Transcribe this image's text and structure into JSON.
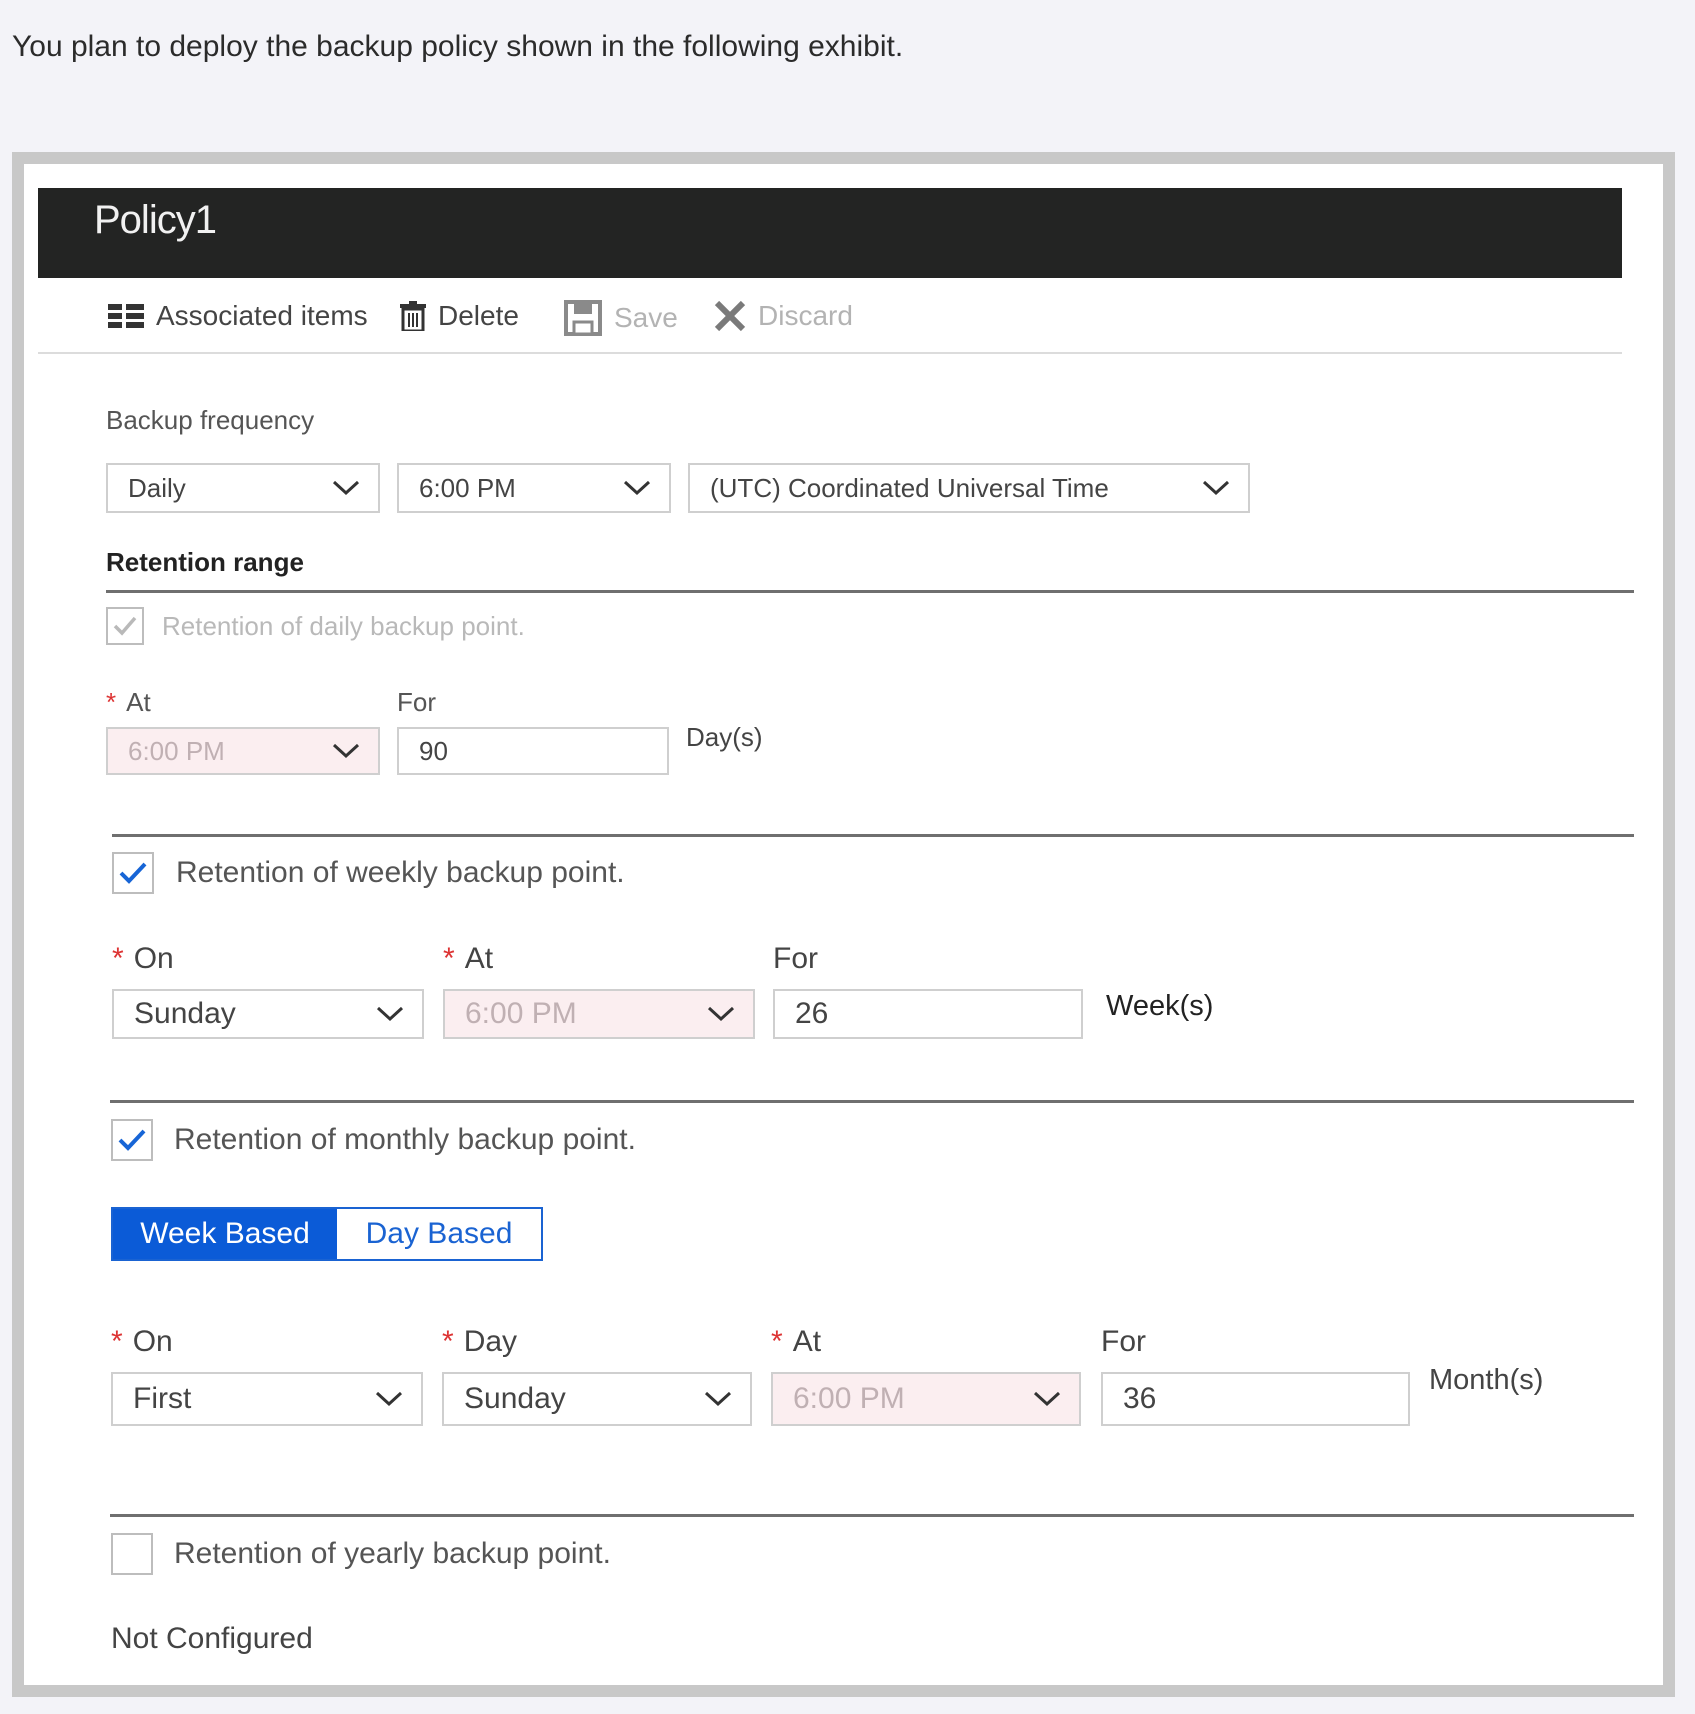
{
  "question": "You plan to deploy the backup policy shown in the following exhibit.",
  "policy": {
    "title": "Policy1",
    "toolbar": {
      "associated_items": "Associated items",
      "delete": "Delete",
      "save": "Save",
      "discard": "Discard"
    },
    "backup_frequency": {
      "label": "Backup frequency",
      "frequency": "Daily",
      "time": "6:00 PM",
      "timezone": "(UTC) Coordinated Universal Time"
    },
    "retention_range": {
      "title": "Retention range",
      "daily": {
        "label": "Retention of daily backup point.",
        "checked": true,
        "at_label": "At",
        "at_value": "6:00 PM",
        "for_label": "For",
        "for_value": "90",
        "unit": "Day(s)"
      },
      "weekly": {
        "label": "Retention of weekly backup point.",
        "checked": true,
        "on_label": "On",
        "on_value": "Sunday",
        "at_label": "At",
        "at_value": "6:00 PM",
        "for_label": "For",
        "for_value": "26",
        "unit": "Week(s)"
      },
      "monthly": {
        "label": "Retention of monthly backup point.",
        "checked": true,
        "tab_week": "Week Based",
        "tab_day": "Day Based",
        "on_label": "On",
        "on_value": "First",
        "day_label": "Day",
        "day_value": "Sunday",
        "at_label": "At",
        "at_value": "6:00 PM",
        "for_label": "For",
        "for_value": "36",
        "unit": "Month(s)"
      },
      "yearly": {
        "label": "Retention of yearly backup point.",
        "checked": false,
        "status": "Not Configured"
      }
    },
    "colors": {
      "title_bar": "#232423",
      "accent": "#0b5bd7",
      "required": "#dd3333",
      "disabled_field": "#fbeef0"
    }
  }
}
